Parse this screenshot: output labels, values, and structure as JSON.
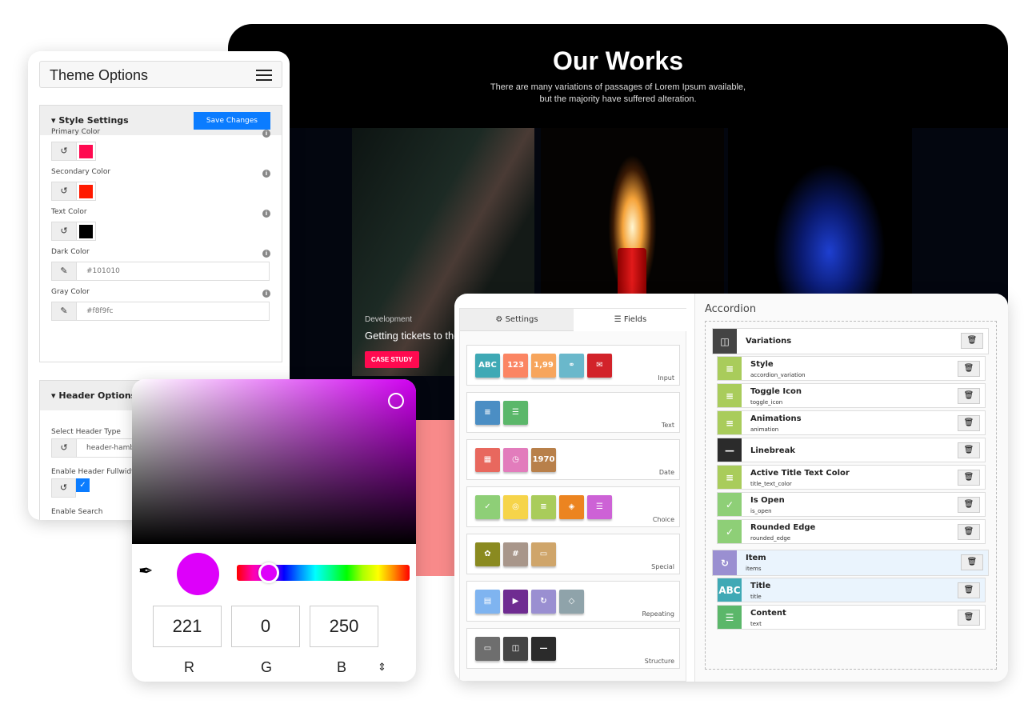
{
  "works": {
    "title": "Our Works",
    "subtitle1": "There are many variations of passages of Lorem Ipsum available,",
    "subtitle2": "but the majority have suffered alteration.",
    "card_category": "Development",
    "card_title": "Getting tickets to the",
    "card_button": "CASE STUDY"
  },
  "theme": {
    "title": "Theme Options",
    "style_section": "Style Settings",
    "save": "Save Changes",
    "fields": [
      {
        "label": "Primary Color",
        "color": "#ff0a50"
      },
      {
        "label": "Secondary Color",
        "color": "#ff1a00"
      },
      {
        "label": "Text Color",
        "color": "#000000"
      },
      {
        "label": "Dark Color",
        "value": "#101010"
      },
      {
        "label": "Gray Color",
        "value": "#f8f9fc"
      }
    ],
    "header_section": "Header Options",
    "header_type_label": "Select Header Type",
    "header_type_value": "header-hamburger",
    "fullwidth_label": "Enable Header Fullwidth",
    "search_label": "Enable Search"
  },
  "picker": {
    "r": "221",
    "g": "0",
    "b": "250",
    "r_label": "R",
    "g_label": "G",
    "b_label": "B",
    "color": "#dd00fa"
  },
  "builder": {
    "tab_settings": "Settings",
    "tab_fields": "Fields",
    "groups": [
      {
        "label": "Input",
        "icons": [
          [
            "ABC",
            "#3fa9b5"
          ],
          [
            "123",
            "#fb8563"
          ],
          [
            "1,99",
            "#f7a55c"
          ],
          [
            "⚭",
            "#6ab8cb"
          ],
          [
            "✉",
            "#d2232a"
          ]
        ]
      },
      {
        "label": "Text",
        "icons": [
          [
            "≡",
            "#4b8ec4"
          ],
          [
            "☰",
            "#5bb76a"
          ]
        ]
      },
      {
        "label": "Date",
        "icons": [
          [
            "▦",
            "#e8685e"
          ],
          [
            "◷",
            "#e27cbc"
          ],
          [
            "1970",
            "#b8804a"
          ]
        ]
      },
      {
        "label": "Choice",
        "icons": [
          [
            "✓",
            "#8ecf77"
          ],
          [
            "◎",
            "#f6d44a"
          ],
          [
            "≡",
            "#a9cc5b"
          ],
          [
            "◈",
            "#ec8420"
          ],
          [
            "☰",
            "#cd62d6"
          ]
        ]
      },
      {
        "label": "Special",
        "icons": [
          [
            "✿",
            "#8a8a20"
          ],
          [
            "#",
            "#a8968a"
          ],
          [
            "▭",
            "#cfa56a"
          ]
        ]
      },
      {
        "label": "Repeating",
        "icons": [
          [
            "▤",
            "#7fb4f0"
          ],
          [
            "▶",
            "#6f2c91"
          ],
          [
            "↻",
            "#9a8fd1"
          ],
          [
            "◇",
            "#8fa3aa"
          ]
        ]
      },
      {
        "label": "Structure",
        "icons": [
          [
            "▭",
            "#6e6e6e"
          ],
          [
            "◫",
            "#444444"
          ],
          [
            "—",
            "#2b2b2b"
          ]
        ]
      }
    ],
    "accordion": "Accordion",
    "rows": [
      {
        "title": "Variations",
        "sub": "",
        "color": "#444444",
        "icon": "◫",
        "level": 0
      },
      {
        "title": "Style",
        "sub": "accordion_variation",
        "color": "#a9cc5b",
        "icon": "≡",
        "level": 1
      },
      {
        "title": "Toggle Icon",
        "sub": "toggle_icon",
        "color": "#a9cc5b",
        "icon": "≡",
        "level": 1
      },
      {
        "title": "Animations",
        "sub": "animation",
        "color": "#a9cc5b",
        "icon": "≡",
        "level": 1
      },
      {
        "title": "Linebreak",
        "sub": "",
        "color": "#2b2b2b",
        "icon": "—",
        "level": 1
      },
      {
        "title": "Active Title Text Color",
        "sub": "title_text_color",
        "color": "#a9cc5b",
        "icon": "≡",
        "level": 1
      },
      {
        "title": "Is Open",
        "sub": "is_open",
        "color": "#8ecf77",
        "icon": "✓",
        "level": 1
      },
      {
        "title": "Rounded Edge",
        "sub": "rounded_edge",
        "color": "#8ecf77",
        "icon": "✓",
        "level": 1
      },
      {
        "title": "Item",
        "sub": "items",
        "color": "#9a8fd1",
        "icon": "↻",
        "level": 0
      },
      {
        "title": "Title",
        "sub": "title",
        "color": "#3fa9b5",
        "icon": "ABC",
        "level": 1
      },
      {
        "title": "Content",
        "sub": "text",
        "color": "#5bb76a",
        "icon": "☰",
        "level": 1
      }
    ]
  }
}
